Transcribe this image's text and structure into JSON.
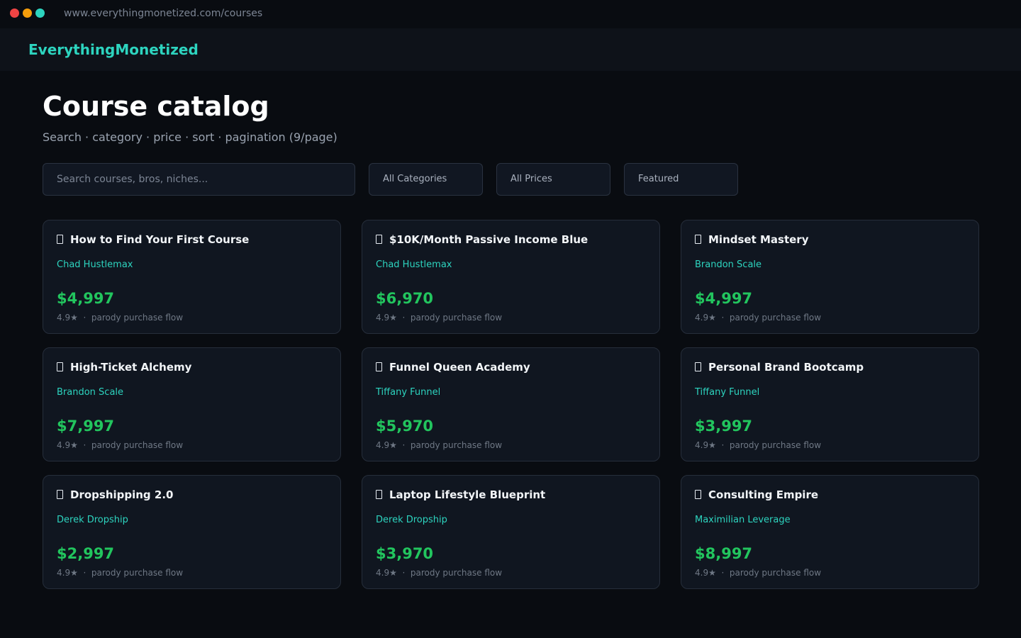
{
  "browser": {
    "url": "www.everythingmonetized.com/courses"
  },
  "navbar": {
    "brand": "EverythingMonetized"
  },
  "header": {
    "title": "Course catalog",
    "subtitle": "Search · category · price · sort · pagination (9/page)"
  },
  "filters": {
    "search_placeholder": "Search courses, bros, niches...",
    "category": "All Categories",
    "price": "All Prices",
    "sort": "Featured"
  },
  "theme": {
    "accent": "#2dd4bf",
    "price": "#22c55e",
    "background": "#090c11"
  },
  "card_icon": "document-icon",
  "courses": [
    {
      "title": "How to Find Your First Course",
      "author": "Chad Hustlemax",
      "price": "$4,997",
      "meta": "4.9★  ·  parody purchase flow"
    },
    {
      "title": "$10K/Month Passive Income Blue",
      "author": "Chad Hustlemax",
      "price": "$6,970",
      "meta": "4.9★  ·  parody purchase flow"
    },
    {
      "title": "Mindset Mastery",
      "author": "Brandon Scale",
      "price": "$4,997",
      "meta": "4.9★  ·  parody purchase flow"
    },
    {
      "title": "High-Ticket Alchemy",
      "author": "Brandon Scale",
      "price": "$7,997",
      "meta": "4.9★  ·  parody purchase flow"
    },
    {
      "title": "Funnel Queen Academy",
      "author": "Tiffany Funnel",
      "price": "$5,970",
      "meta": "4.9★  ·  parody purchase flow"
    },
    {
      "title": "Personal Brand Bootcamp",
      "author": "Tiffany Funnel",
      "price": "$3,997",
      "meta": "4.9★  ·  parody purchase flow"
    },
    {
      "title": "Dropshipping 2.0",
      "author": "Derek Dropship",
      "price": "$2,997",
      "meta": "4.9★  ·  parody purchase flow"
    },
    {
      "title": "Laptop Lifestyle Blueprint",
      "author": "Derek Dropship",
      "price": "$3,970",
      "meta": "4.9★  ·  parody purchase flow"
    },
    {
      "title": "Consulting Empire",
      "author": "Maximilian Leverage",
      "price": "$8,997",
      "meta": "4.9★  ·  parody purchase flow"
    }
  ]
}
